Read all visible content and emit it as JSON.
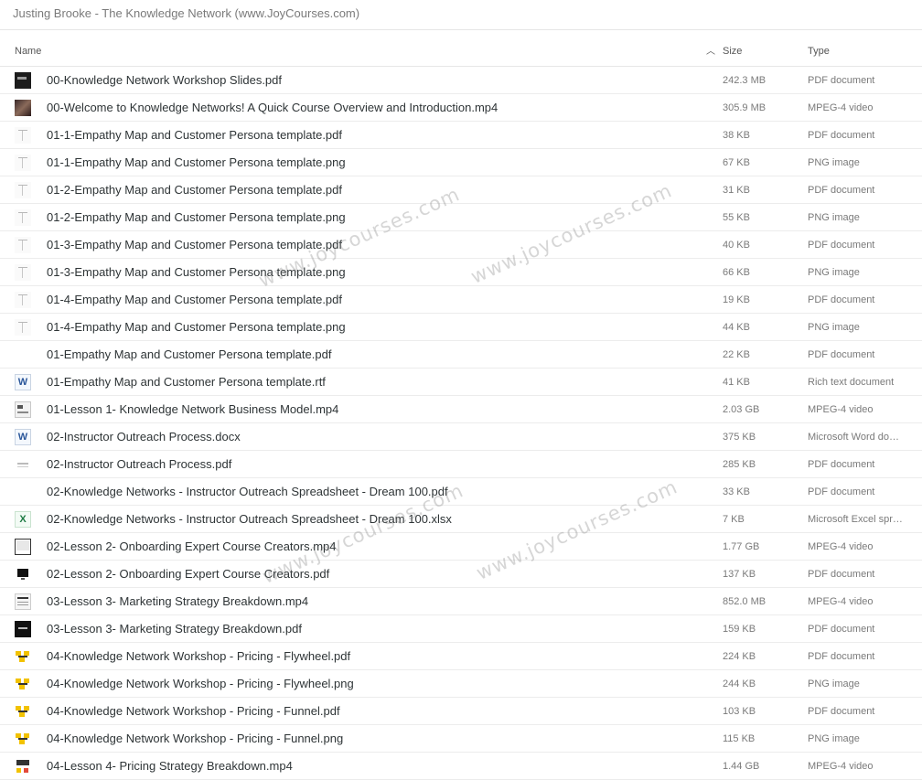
{
  "window": {
    "title": "Justing Brooke - The Knowledge Network (www.JoyCourses.com)"
  },
  "columns": {
    "name": "Name",
    "size": "Size",
    "type": "Type"
  },
  "watermarks": [
    "www.joycourses.com",
    "www.joycourses.com",
    "www.joycourses.com",
    "www.joycourses.com"
  ],
  "files": [
    {
      "name": "00-Knowledge Network Workshop Slides.pdf",
      "size": "242.3 MB",
      "type": "PDF document",
      "thumb": "t-dark"
    },
    {
      "name": "00-Welcome to Knowledge Networks! A Quick Course Overview and Introduction.mp4",
      "size": "305.9 MB",
      "type": "MPEG-4 video",
      "thumb": "t-photo"
    },
    {
      "name": "01-1-Empathy Map and Customer Persona template.pdf",
      "size": "38 KB",
      "type": "PDF document",
      "thumb": "t-tmpl"
    },
    {
      "name": "01-1-Empathy Map and Customer Persona template.png",
      "size": "67 KB",
      "type": "PNG image",
      "thumb": "t-tmpl"
    },
    {
      "name": "01-2-Empathy Map and Customer Persona template.pdf",
      "size": "31 KB",
      "type": "PDF document",
      "thumb": "t-tmpl"
    },
    {
      "name": "01-2-Empathy Map and Customer Persona template.png",
      "size": "55 KB",
      "type": "PNG image",
      "thumb": "t-tmpl"
    },
    {
      "name": "01-3-Empathy Map and Customer Persona template.pdf",
      "size": "40 KB",
      "type": "PDF document",
      "thumb": "t-tmpl"
    },
    {
      "name": "01-3-Empathy Map and Customer Persona template.png",
      "size": "66 KB",
      "type": "PNG image",
      "thumb": "t-tmpl"
    },
    {
      "name": "01-4-Empathy Map and Customer Persona template.pdf",
      "size": "19 KB",
      "type": "PDF document",
      "thumb": "t-tmpl"
    },
    {
      "name": "01-4-Empathy Map and Customer Persona template.png",
      "size": "44 KB",
      "type": "PNG image",
      "thumb": "t-tmpl"
    },
    {
      "name": "01-Empathy Map and Customer Persona template.pdf",
      "size": "22 KB",
      "type": "PDF document",
      "thumb": "t-blank"
    },
    {
      "name": "01-Empathy Map and Customer Persona template.rtf",
      "size": "41 KB",
      "type": "Rich text document",
      "thumb": "t-word",
      "glyph": "W"
    },
    {
      "name": "01-Lesson 1- Knowledge Network Business Model.mp4",
      "size": "2.03 GB",
      "type": "MPEG-4 video",
      "thumb": "t-slide"
    },
    {
      "name": "02-Instructor Outreach Process.docx",
      "size": "375 KB",
      "type": "Microsoft Word do…",
      "thumb": "t-word",
      "glyph": "W"
    },
    {
      "name": "02-Instructor Outreach Process.pdf",
      "size": "285 KB",
      "type": "PDF document",
      "thumb": "t-gray"
    },
    {
      "name": "02-Knowledge Networks - Instructor Outreach Spreadsheet - Dream 100.pdf",
      "size": "33 KB",
      "type": "PDF document",
      "thumb": "t-blank"
    },
    {
      "name": "02-Knowledge Networks - Instructor Outreach Spreadsheet - Dream 100.xlsx",
      "size": "7 KB",
      "type": "Microsoft Excel spr…",
      "thumb": "t-excel",
      "glyph": "X"
    },
    {
      "name": "02-Lesson 2- Onboarding Expert Course Creators.mp4",
      "size": "1.77 GB",
      "type": "MPEG-4 video",
      "thumb": "t-screen"
    },
    {
      "name": "02-Lesson 2- Onboarding Expert Course Creators.pdf",
      "size": "137 KB",
      "type": "PDF document",
      "thumb": "t-monitor"
    },
    {
      "name": "03-Lesson 3- Marketing Strategy Breakdown.mp4",
      "size": "852.0 MB",
      "type": "MPEG-4 video",
      "thumb": "t-doc"
    },
    {
      "name": "03-Lesson 3- Marketing Strategy Breakdown.pdf",
      "size": "159 KB",
      "type": "PDF document",
      "thumb": "t-black"
    },
    {
      "name": "04-Knowledge Network Workshop - Pricing - Flywheel.pdf",
      "size": "224 KB",
      "type": "PDF document",
      "thumb": "t-yellow"
    },
    {
      "name": "04-Knowledge Network Workshop - Pricing - Flywheel.png",
      "size": "244 KB",
      "type": "PNG image",
      "thumb": "t-yellow"
    },
    {
      "name": "04-Knowledge Network Workshop - Pricing - Funnel.pdf",
      "size": "103 KB",
      "type": "PDF document",
      "thumb": "t-yellow"
    },
    {
      "name": "04-Knowledge Network Workshop - Pricing - Funnel.png",
      "size": "115 KB",
      "type": "PNG image",
      "thumb": "t-yellow"
    },
    {
      "name": "04-Lesson 4- Pricing Strategy Breakdown.mp4",
      "size": "1.44 GB",
      "type": "MPEG-4 video",
      "thumb": "t-lesson"
    }
  ]
}
